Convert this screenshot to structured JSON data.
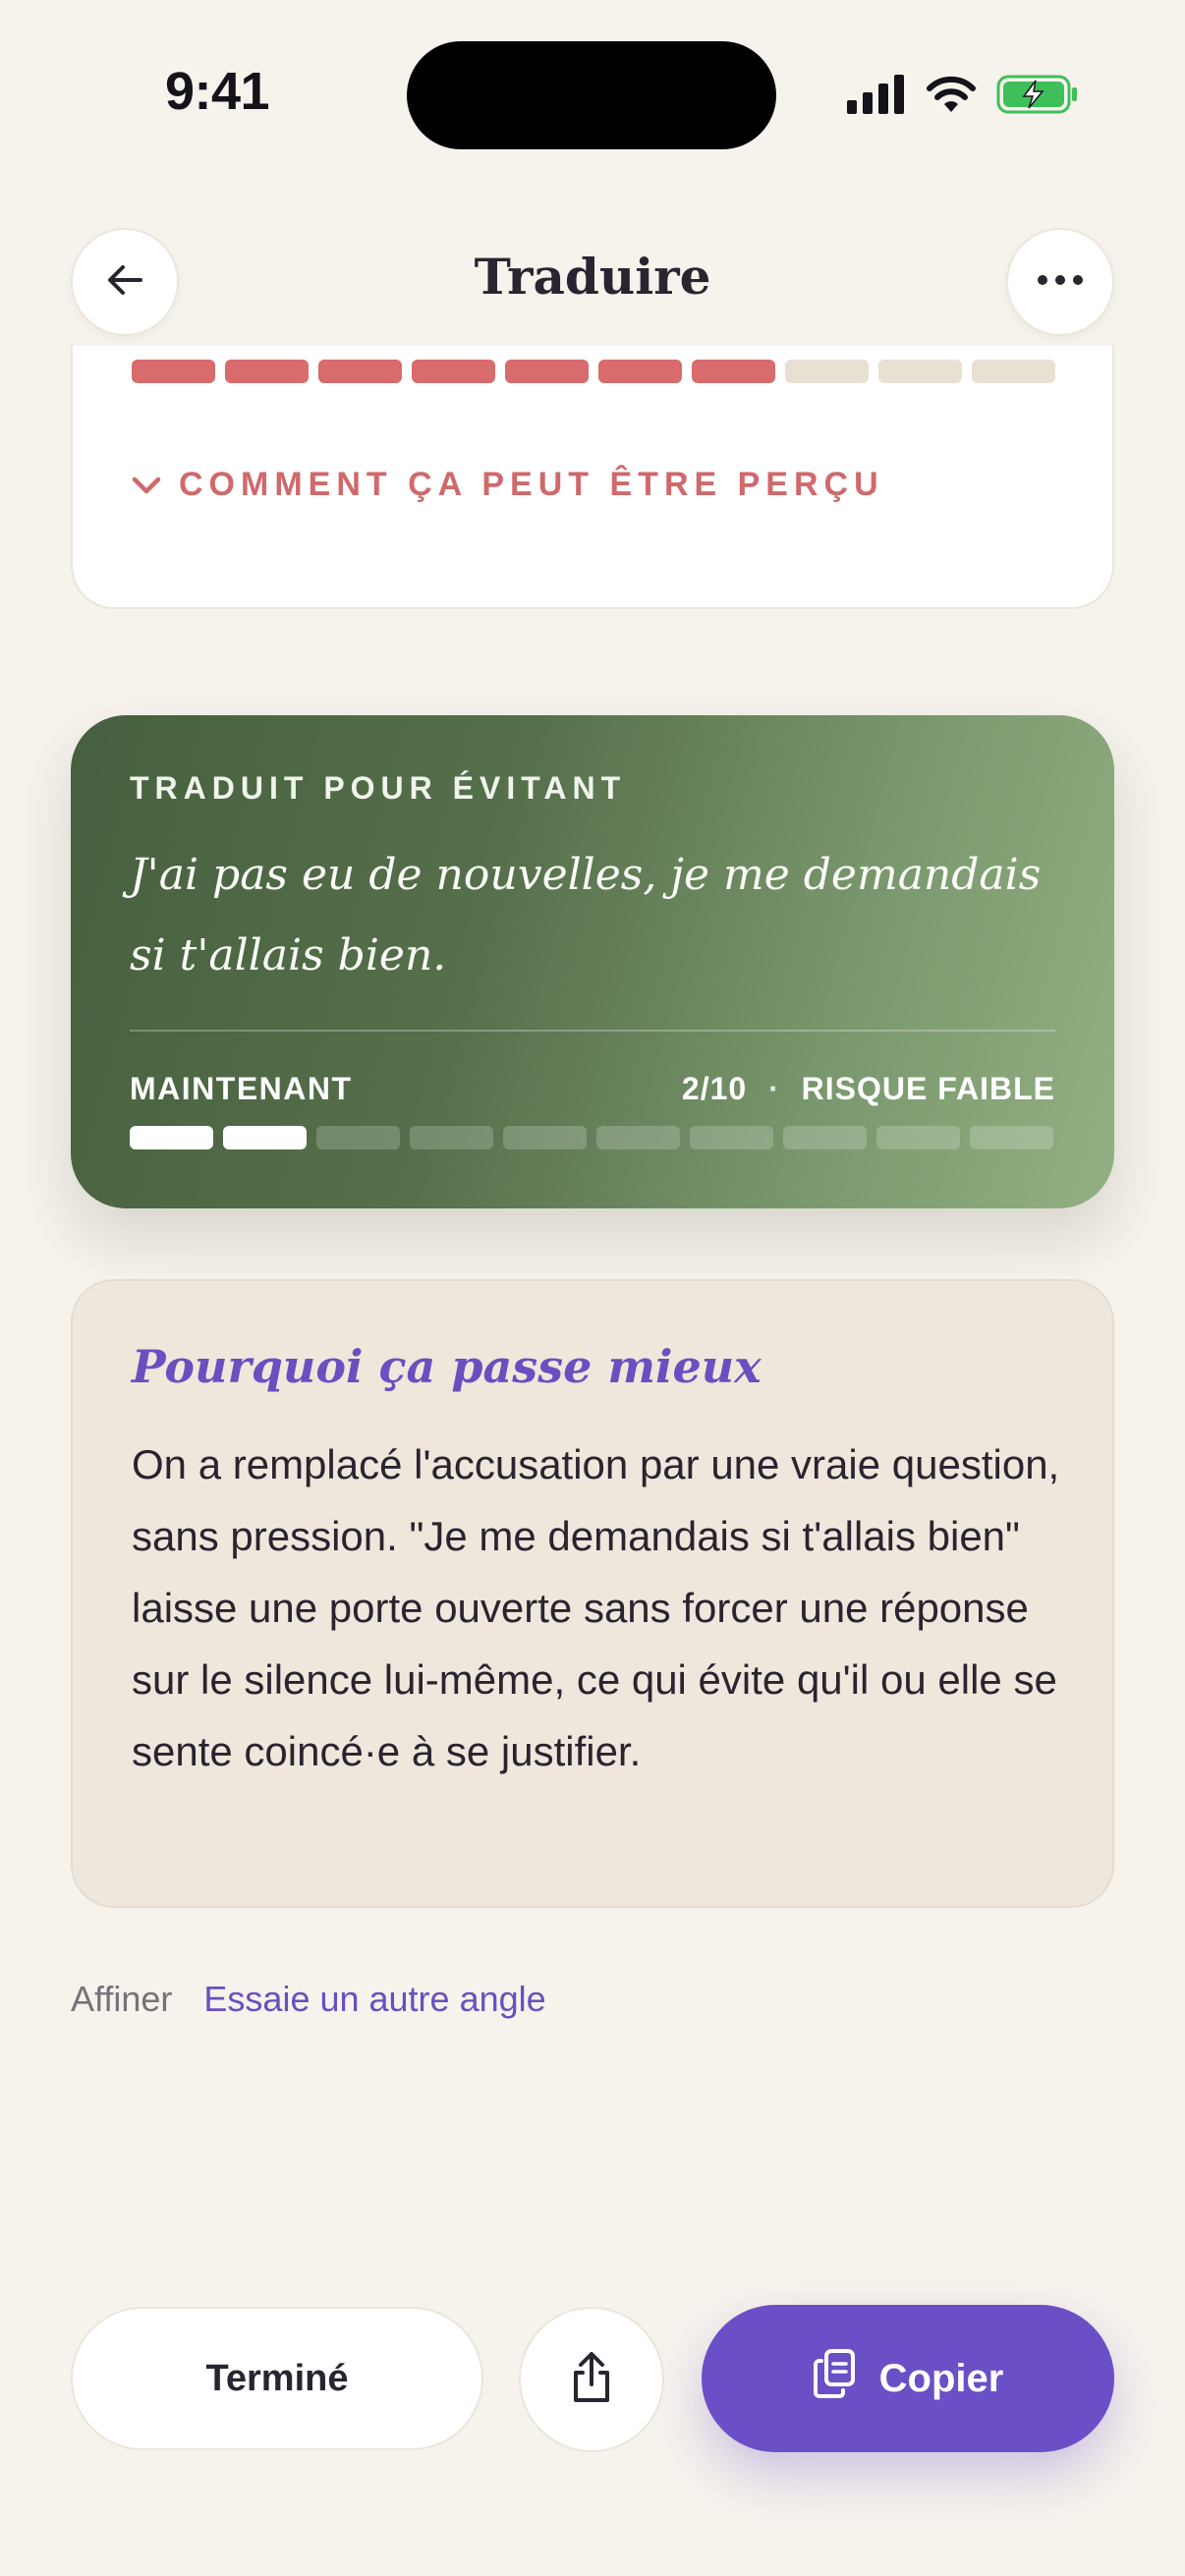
{
  "status_bar": {
    "time": "9:41"
  },
  "header": {
    "title": "Traduire"
  },
  "previous_card": {
    "meter": {
      "filled": 7,
      "total": 10,
      "color": "#d86b6c"
    },
    "toggle_label": "COMMENT ÇA PEUT ÊTRE PERÇU"
  },
  "translation_card": {
    "label": "TRADUIT POUR ÉVITANT",
    "quote": "J'ai pas eu de nouvelles, je me demandais si t'allais bien.",
    "now_label": "MAINTENANT",
    "score": "2/10",
    "separator": "·",
    "risk_label": "RISQUE FAIBLE",
    "meter": {
      "filled": 2,
      "total": 10
    }
  },
  "explanation": {
    "title": "Pourquoi ça passe mieux",
    "body": "On a remplacé l'accusation par une vraie question, sans pression. \"Je me demandais si t'allais bien\" laisse une porte ouverte sans forcer une réponse sur le silence lui-même, ce qui évite qu'il ou elle se sente coincé·e à se justifier."
  },
  "refine": {
    "label": "Affiner",
    "link": "Essaie un autre angle"
  },
  "actions": {
    "done_label": "Terminé",
    "copy_label": "Copier"
  },
  "colors": {
    "accent": "#6b4fc6",
    "danger": "#d86b6c",
    "green": "#56704b",
    "background": "#f6f2ec"
  }
}
